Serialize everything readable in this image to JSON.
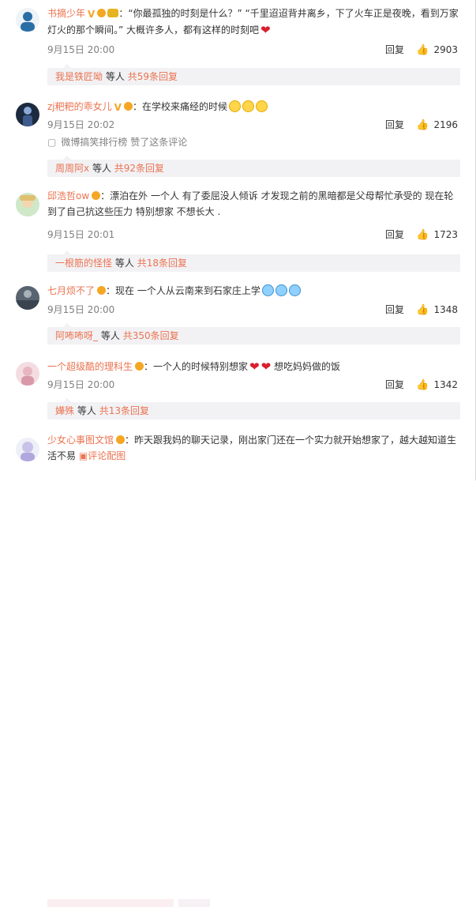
{
  "comments": [
    {
      "name": "书摘少年",
      "text": "：“你最孤独的时刻是什么？” “千里迢迢背井离乡，下了火车正是夜晚，看到万家灯火的那个瞬间。” 大概许多人，都有这样的时刻吧",
      "time": "9月15日 20:00",
      "reply": "回复",
      "likes": "2903",
      "sub_user": "我是铁匠呦",
      "sub_mid": "等人",
      "sub_total": "共59条回复"
    },
    {
      "name": "zj粑粑的乖女儿",
      "text": "：在学校来痛经的时候",
      "time": "9月15日 20:02",
      "reply": "回复",
      "likes": "2196",
      "meta1": "微博搞笑排行榜",
      "meta2": "赞了这条评论",
      "sub_user": "周周阿x",
      "sub_mid": "等人",
      "sub_total": "共92条回复"
    },
    {
      "name": "邱浩哲ow",
      "text": "：漂泊在外 一个人 有了委屈没人倾诉 才发现之前的黑暗都是父母帮忙承受的 现在轮到了自己抗这些压力  特别想家 不想长大 .",
      "time": "9月15日 20:01",
      "reply": "回复",
      "likes": "1723",
      "sub_user": "一根筋的怪怪",
      "sub_mid": "等人",
      "sub_total": "共18条回复"
    },
    {
      "name": "七月烦不了",
      "text": "：现在 一个人从云南来到石家庄上学",
      "time": "9月15日 20:00",
      "reply": "回复",
      "likes": "1348",
      "sub_user": "阿咘咘呀_",
      "sub_mid": "等人",
      "sub_total": "共350条回复"
    },
    {
      "name": "一个超级酷的理科生",
      "text": "：一个人的时候特别想家",
      "text_after": "想吃妈妈做的饭",
      "time": "9月15日 20:00",
      "reply": "回复",
      "likes": "1342",
      "sub_user": "嬅殊",
      "sub_mid": "等人",
      "sub_total": "共13条回复"
    },
    {
      "name": "少女心事图文馆",
      "text": "：昨天跟我妈的聊天记录，刚出家门还在一个实力就开始想家了，越大越知道生活不易",
      "pic_label": "评论配图"
    }
  ],
  "colors": {
    "name": "#eb7350",
    "vip": "#f5a623",
    "sub_bg": "#f2f2f5"
  },
  "icons": [
    "thumb-up-icon",
    "vip-icon",
    "emoji-smile-icon",
    "emoji-cry-icon",
    "broken-heart-icon",
    "image-icon",
    "like-meta-icon"
  ]
}
